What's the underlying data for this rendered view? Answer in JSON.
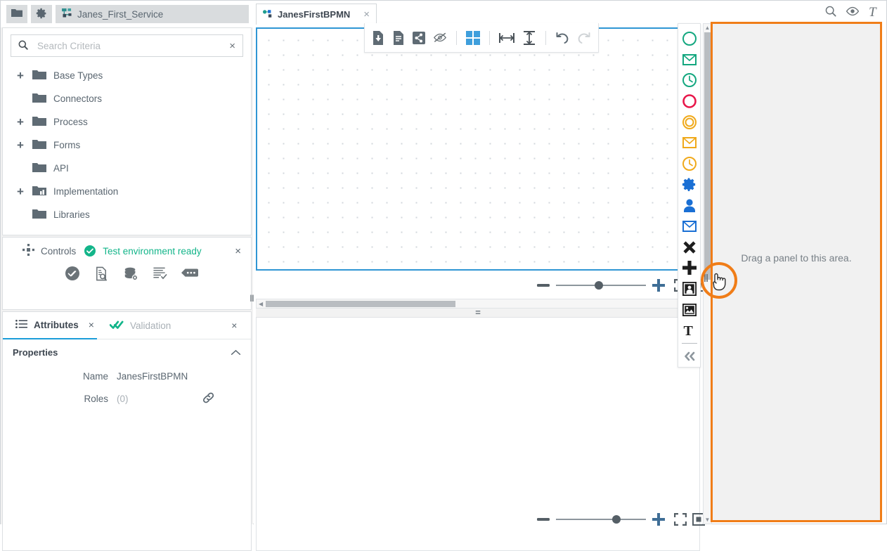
{
  "topbar": {
    "folder_button": "folder-icon",
    "settings_button": "gear-icon",
    "service_tab_label": "Janes_First_Service",
    "document_tab_label": "JanesFirstBPMN",
    "document_tab_close": "×",
    "right_icons": [
      "search-icon",
      "eye-icon",
      "text-icon"
    ]
  },
  "sidebar": {
    "search": {
      "placeholder": "Search Criteria",
      "value": "",
      "clear_label": "×"
    },
    "tree": [
      {
        "label": "Base Types",
        "expandable": true,
        "toggle": "+"
      },
      {
        "label": "Connectors",
        "expandable": false,
        "toggle": ""
      },
      {
        "label": "Process",
        "expandable": true,
        "toggle": "+"
      },
      {
        "label": "Forms",
        "expandable": true,
        "toggle": "+"
      },
      {
        "label": "API",
        "expandable": false,
        "toggle": ""
      },
      {
        "label": "Implementation",
        "expandable": true,
        "toggle": "+"
      },
      {
        "label": "Libraries",
        "expandable": false,
        "toggle": ""
      }
    ],
    "controls": {
      "title": "Controls",
      "status": "Test environment ready",
      "status_color": "#13b58a",
      "close_label": "×",
      "actions": [
        {
          "name": "run-test-icon"
        },
        {
          "name": "document-search-icon"
        },
        {
          "name": "database-clear-icon"
        },
        {
          "name": "log-check-icon"
        },
        {
          "name": "comment-more-icon"
        }
      ]
    },
    "attributes": {
      "tabs": [
        {
          "label": "Attributes",
          "active": true,
          "close_label": "×",
          "icon": "list-icon"
        },
        {
          "label": "Validation",
          "active": false,
          "close_label": "×",
          "icon": "double-check-icon"
        }
      ],
      "section_title": "Properties",
      "section_collapse": "chevron-up-icon",
      "rows": [
        {
          "key": "Name",
          "value": "JanesFirstBPMN",
          "muted": false,
          "has_link": false
        },
        {
          "key": "Roles",
          "value": "(0)",
          "muted": true,
          "has_link": true
        }
      ]
    }
  },
  "modeler": {
    "toolbar": [
      {
        "name": "export-file-icon",
        "active": false
      },
      {
        "name": "document-icon",
        "active": false
      },
      {
        "name": "share-icon",
        "active": false
      },
      {
        "name": "hide-eye-icon",
        "active": false
      },
      {
        "name": "grid-icon",
        "active": true
      },
      {
        "name": "align-horizontal-icon",
        "active": false
      },
      {
        "name": "align-vertical-icon",
        "active": false
      },
      {
        "name": "undo-icon",
        "active": false
      },
      {
        "name": "redo-icon",
        "active": false
      }
    ],
    "zoom_top": {
      "minus_label": "−",
      "plus_label": "+",
      "knob_percent": 55,
      "fit_screen_icon": "fit-screen-icon",
      "fit_page_icon": "fit-page-icon"
    },
    "zoom_bottom": {
      "minus_label": "−",
      "plus_label": "+",
      "knob_percent": 70,
      "fit_screen_icon": "fit-screen-icon",
      "fit_page_icon": "fit-page-icon"
    },
    "splitter_handle": "=",
    "vsplitter_handle": "‖"
  },
  "palette": {
    "items": [
      {
        "name": "start-event-icon",
        "color": "#13a77f"
      },
      {
        "name": "start-message-event-icon",
        "color": "#13a77f"
      },
      {
        "name": "start-timer-event-icon",
        "color": "#13a77f"
      },
      {
        "name": "end-event-icon",
        "color": "#e8174a"
      },
      {
        "name": "intermediate-event-icon",
        "color": "#f0a91b"
      },
      {
        "name": "intermediate-message-event-icon",
        "color": "#f0a91b"
      },
      {
        "name": "intermediate-timer-event-icon",
        "color": "#f0a91b"
      },
      {
        "name": "service-task-icon",
        "color": "#1a6fd4"
      },
      {
        "name": "user-task-icon",
        "color": "#1a6fd4"
      },
      {
        "name": "send-task-icon",
        "color": "#1a6fd4"
      },
      {
        "name": "exclusive-gateway-icon",
        "color": "#1d1d1d"
      },
      {
        "name": "parallel-gateway-icon",
        "color": "#1d1d1d"
      },
      {
        "name": "pool-icon",
        "color": "#1d1d1d"
      },
      {
        "name": "image-icon",
        "color": "#1d1d1d"
      },
      {
        "name": "text-annotation-icon",
        "color": "#1d1d1d"
      },
      {
        "name": "collapse-palette-icon",
        "color": "#8d969d"
      }
    ]
  },
  "droparea": {
    "message": "Drag a panel to this area.",
    "border_color": "#f07d18",
    "handle": "‖"
  }
}
